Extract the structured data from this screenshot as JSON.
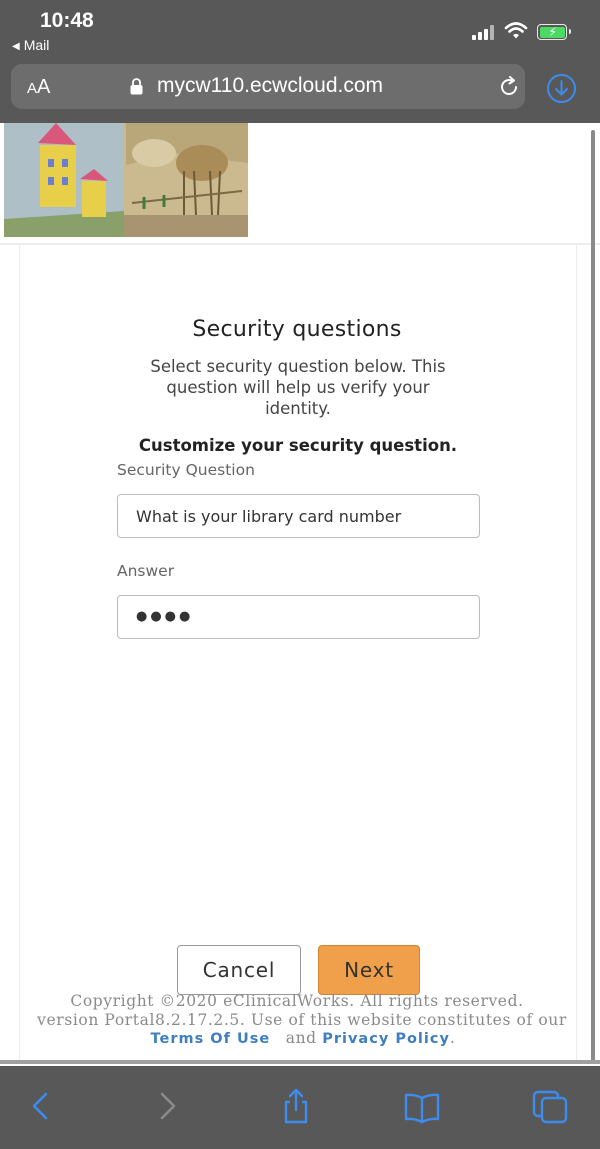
{
  "status_bar": {
    "time": "10:48",
    "back_app": "Mail"
  },
  "address_bar": {
    "text_size_label_small": "A",
    "text_size_label_large": "A",
    "url": "mycw110.ecwcloud.com"
  },
  "page": {
    "title": "Security questions",
    "subtitle": "Select security question below. This question will help us verify your identity.",
    "customize_label": "Customize your security question.",
    "security_question_label": "Security Question",
    "security_question_value": "What is your library card number",
    "answer_label": "Answer",
    "answer_value": "●●●●",
    "cancel_label": "Cancel",
    "next_label": "Next"
  },
  "footer": {
    "copyright": "Copyright ©2020 eClinicalWorks. All rights reserved.",
    "version_line": "version Portal8.2.17.2.5.  Use of this website constitutes of our",
    "terms_link": "Terms Of Use",
    "and_text": "and",
    "privacy_link": "Privacy Policy",
    "period": "."
  },
  "colors": {
    "accent_blue": "#3c8cf0",
    "next_button": "#f0a04b",
    "bar_gray": "#585858",
    "link_blue": "#3f7fbf"
  },
  "icons": [
    "signal-icon",
    "wifi-icon",
    "battery-icon",
    "lock-icon",
    "reload-icon",
    "download-icon",
    "back-icon",
    "forward-icon",
    "share-icon",
    "bookmarks-icon",
    "tabs-icon"
  ]
}
